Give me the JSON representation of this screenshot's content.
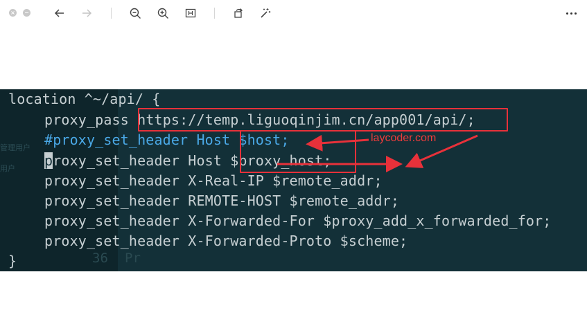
{
  "toolbar": {
    "icons": [
      "close-icon",
      "minimize-icon",
      "back-arrow-icon",
      "forward-arrow-icon",
      "zoom-out-icon",
      "zoom-in-icon",
      "fit-size-icon",
      "rotate-icon",
      "magic-wand-icon",
      "more-icon"
    ]
  },
  "image": {
    "code_lines": [
      "location ^~/api/ {",
      "proxy_pass",
      "https://temp.liguoqinjim.cn/app001/api/;",
      "#proxy_set_header Host $host;",
      "p",
      "roxy_set_header Host $proxy_host;",
      "proxy_set_header X-Real-IP $remote_addr;",
      "proxy_set_header REMOTE-HOST $remote_addr;",
      "proxy_set_header X-Forwarded-For $proxy_add_x_forwarded_for;",
      "proxy_set_header X-Forwarded-Proto $scheme;",
      "}"
    ],
    "watermark": "laycoder.com",
    "ghost_text": {
      "side_label_1": "管理用户",
      "side_label_2": "用户",
      "line_no": "36",
      "line_frag": "Pr"
    },
    "colors": {
      "background": "#133038",
      "text": "#c6cfd2",
      "comment_keyword": "#4aa8e6",
      "annotation": "#e8313a"
    }
  }
}
